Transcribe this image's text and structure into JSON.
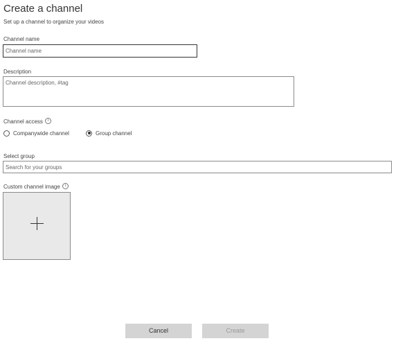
{
  "header": {
    "title": "Create a channel",
    "subtitle": "Set up a channel to organize your videos"
  },
  "channel_name": {
    "label": "Channel name",
    "placeholder": "Channel name",
    "value": ""
  },
  "description": {
    "label": "Description",
    "placeholder": "Channel description, #tag",
    "value": ""
  },
  "channel_access": {
    "label": "Channel access",
    "info_icon": "info-icon",
    "options": [
      {
        "label": "Companywide channel",
        "selected": false
      },
      {
        "label": "Group channel",
        "selected": true
      }
    ]
  },
  "select_group": {
    "label": "Select group",
    "placeholder": "Search for your groups",
    "value": ""
  },
  "custom_image": {
    "label": "Custom channel image",
    "info_icon": "info-icon",
    "add_icon": "plus-icon"
  },
  "footer": {
    "cancel_label": "Cancel",
    "create_label": "Create"
  }
}
